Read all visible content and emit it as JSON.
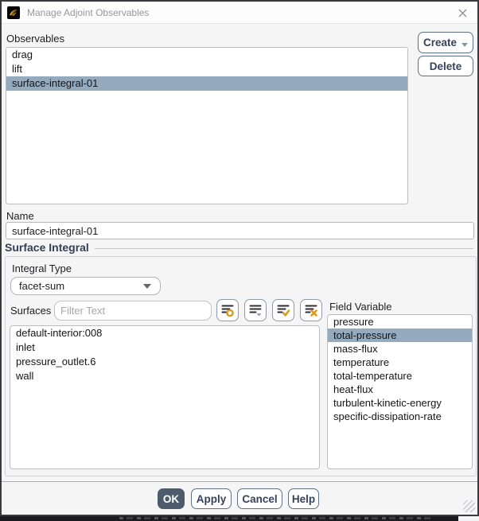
{
  "window": {
    "title": "Manage Adjoint Observables"
  },
  "observables": {
    "label": "Observables",
    "items": [
      "drag",
      "lift",
      "surface-integral-01"
    ],
    "selected_item": "surface-integral-01",
    "create_label": "Create",
    "delete_label": "Delete"
  },
  "name_field": {
    "label": "Name",
    "value": "surface-integral-01"
  },
  "surface_integral": {
    "title": "Surface Integral",
    "integral_type": {
      "label": "Integral Type",
      "value": "facet-sum"
    },
    "surfaces": {
      "label": "Surfaces",
      "filter_placeholder": "Filter Text",
      "items": [
        "default-interior:008",
        "inlet",
        "pressure_outlet.6",
        "wall"
      ]
    },
    "toolbar": {
      "icons": [
        "filter-options-icon",
        "list-display-options-icon",
        "select-all-icon",
        "deselect-all-icon"
      ]
    },
    "field_variable": {
      "label": "Field Variable",
      "items": [
        "pressure",
        "total-pressure",
        "mass-flux",
        "temperature",
        "total-temperature",
        "heat-flux",
        "turbulent-kinetic-energy",
        "specific-dissipation-rate"
      ],
      "selected_item": "total-pressure",
      "selected_index": 1
    }
  },
  "footer": {
    "ok_label": "OK",
    "apply_label": "Apply",
    "cancel_label": "Cancel",
    "help_label": "Help"
  },
  "colors": {
    "selection": "#93AABF",
    "accent_gold": "#D99B1F",
    "ok_button": "#4D5B6C",
    "heading_navy": "#333F54",
    "button_border": "#5F7089"
  }
}
